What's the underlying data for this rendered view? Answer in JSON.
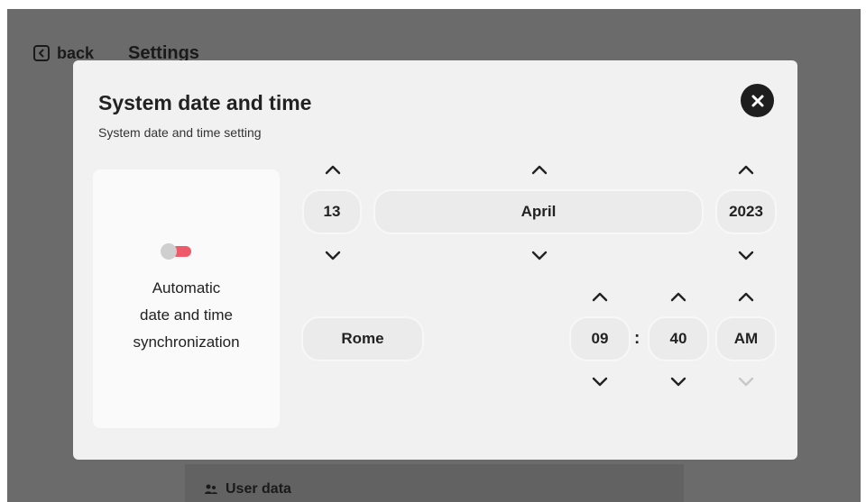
{
  "background": {
    "back_label": "back",
    "title": "Settings",
    "user_data_label": "User data"
  },
  "modal": {
    "title": "System date and time",
    "subtitle": "System date and time setting"
  },
  "sync": {
    "label_line1": "Automatic",
    "label_line2": "date and time",
    "label_line3": "synchronization",
    "toggle_on": true
  },
  "date": {
    "day": "13",
    "month": "April",
    "year": "2023"
  },
  "time": {
    "timezone": "Rome",
    "hour": "09",
    "separator": ":",
    "minute": "40",
    "period": "AM"
  },
  "colors": {
    "toggle_accent": "#ef5a6b",
    "modal_bg": "#f1f1f1",
    "overlay_bg": "#6b6b6b"
  },
  "icons": {
    "back": "chevron-left-icon",
    "close": "close-icon",
    "up": "chevron-up-icon",
    "down": "chevron-down-icon",
    "user_data": "users-icon"
  }
}
